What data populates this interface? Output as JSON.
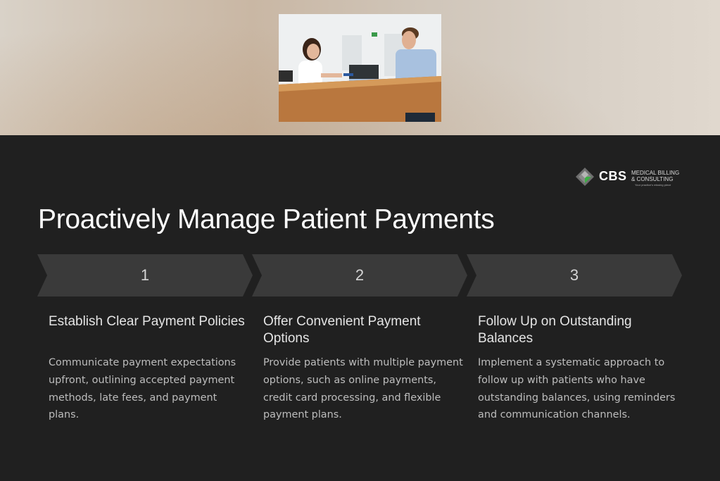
{
  "page": {
    "title": "Proactively Manage Patient Payments"
  },
  "logo": {
    "abbr": "CBS",
    "line1": "MEDICAL BILLING",
    "line2": "& CONSULTING",
    "tagline": "Your practice's missing piece"
  },
  "steps": [
    {
      "number": "1",
      "title": "Establish Clear Payment Policies",
      "description": "Communicate payment expectations upfront, outlining accepted payment methods, late fees, and payment plans."
    },
    {
      "number": "2",
      "title": "Offer Convenient Payment Options",
      "description": "Provide patients with multiple payment options, such as online payments, credit card processing, and flexible payment plans."
    },
    {
      "number": "3",
      "title": "Follow Up on Outstanding Balances",
      "description": "Implement a systematic approach to follow up with patients who have outstanding balances, using reminders and communication channels."
    }
  ],
  "colors": {
    "background": "#202020",
    "chevron": "#3a3a3a",
    "accent_green": "#3cb043"
  }
}
